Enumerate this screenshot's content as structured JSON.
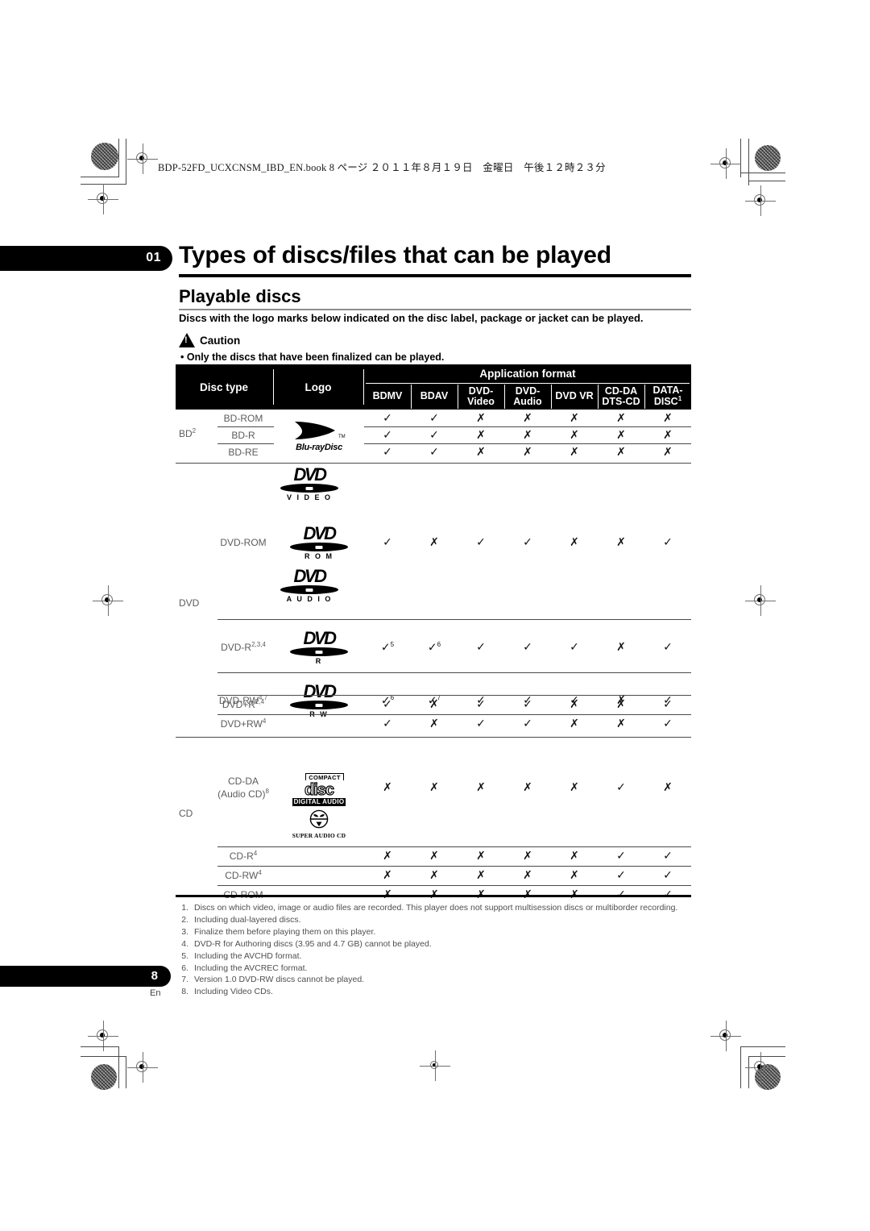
{
  "print_marks": {
    "file_info": "BDP-52FD_UCXCNSM_IBD_EN.book  8 ページ  ２０１１年８月１９日　金曜日　午後１２時２３分"
  },
  "chapter": {
    "number": "01",
    "title": "Types of discs/files that can be played"
  },
  "section": {
    "title": "Playable discs",
    "intro": "Discs with the logo marks below indicated on the disc label, package or jacket can be played."
  },
  "caution": {
    "label": "Caution",
    "bullet": "• Only the discs that have been finalized can be played."
  },
  "table": {
    "header": {
      "disc_type": "Disc type",
      "logo": "Logo",
      "application_format": "Application format",
      "columns": [
        {
          "line1": "BDMV",
          "line2": ""
        },
        {
          "line1": "BDAV",
          "line2": ""
        },
        {
          "line1": "DVD-",
          "line2": "Video"
        },
        {
          "line1": "DVD-",
          "line2": "Audio"
        },
        {
          "line1": "DVD VR",
          "line2": ""
        },
        {
          "line1": "CD-DA",
          "line2": "DTS-CD"
        },
        {
          "line1": "DATA-",
          "line2": "DISC",
          "sup": "1"
        }
      ]
    },
    "groups": [
      {
        "name": "BD",
        "name_sup": "2",
        "rows": [
          {
            "type": "BD-ROM",
            "marks": [
              "yes",
              "yes",
              "no",
              "no",
              "no",
              "no",
              "no"
            ]
          },
          {
            "type": "BD-R",
            "marks": [
              "yes",
              "yes",
              "no",
              "no",
              "no",
              "no",
              "no"
            ]
          },
          {
            "type": "BD-RE",
            "marks": [
              "yes",
              "yes",
              "no",
              "no",
              "no",
              "no",
              "no"
            ]
          }
        ],
        "logos": [
          "blu-ray-disc"
        ]
      },
      {
        "name": "DVD",
        "name_sup": "",
        "rows": [
          {
            "type": "DVD-ROM",
            "type_sup": "",
            "marks": [
              "yes",
              "no",
              "yes",
              "yes",
              "no",
              "no",
              "yes"
            ]
          },
          {
            "type": "DVD-R",
            "type_sup": "2,3,4",
            "marks": [
              "yes",
              "yes",
              "yes",
              "yes",
              "yes",
              "no",
              "yes"
            ],
            "mark_sups": [
              "5",
              "6",
              "",
              "",
              "",
              "",
              ""
            ]
          },
          {
            "type": "DVD-RW",
            "type_sup": "4,7",
            "marks": [
              "yes",
              "yes",
              "yes",
              "yes",
              "yes",
              "no",
              "yes"
            ],
            "mark_sups": [
              "6",
              "7",
              "",
              "",
              "",
              "",
              ""
            ]
          },
          {
            "type": "DVD+R",
            "type_sup": "2,4",
            "marks": [
              "yes",
              "no",
              "yes",
              "yes",
              "no",
              "no",
              "yes"
            ]
          },
          {
            "type": "DVD+RW",
            "type_sup": "4",
            "marks": [
              "yes",
              "no",
              "yes",
              "yes",
              "no",
              "no",
              "yes"
            ]
          }
        ],
        "logos": [
          "dvd-video",
          "dvd-rom",
          "dvd-audio",
          "dvd-r",
          "dvd-rw"
        ]
      },
      {
        "name": "CD",
        "name_sup": "",
        "rows": [
          {
            "type": "CD-DA",
            "type_line2": "(Audio CD)",
            "type_sup": "8",
            "marks": [
              "no",
              "no",
              "no",
              "no",
              "no",
              "yes",
              "no"
            ]
          },
          {
            "type": "CD-R",
            "type_sup": "4",
            "marks": [
              "no",
              "no",
              "no",
              "no",
              "no",
              "yes",
              "yes"
            ]
          },
          {
            "type": "CD-RW",
            "type_sup": "4",
            "marks": [
              "no",
              "no",
              "no",
              "no",
              "no",
              "yes",
              "yes"
            ]
          },
          {
            "type": "CD-ROM",
            "type_sup": "",
            "marks": [
              "no",
              "no",
              "no",
              "no",
              "no",
              "yes",
              "yes"
            ]
          }
        ],
        "logos": [
          "compact-disc-digital-audio",
          "super-audio-cd"
        ]
      }
    ],
    "marks": {
      "yes": "✓",
      "no": "✗"
    }
  },
  "logo_text": {
    "bluray_word": "Blu-rayDisc",
    "dvd_word": "DVD",
    "dvd_video_sub": "V I D E O",
    "dvd_rom_sub": "R O M",
    "dvd_audio_sub": "A U D I O",
    "dvd_r_sub": "R",
    "dvd_rw_sub": "R W",
    "cd_compact": "COMPACT",
    "cd_disc": "disc",
    "cd_digital_audio": "DIGITAL AUDIO",
    "sacd_text": "SUPER AUDIO CD"
  },
  "footnotes": [
    {
      "n": "1.",
      "text": "Discs on which video, image or audio files are recorded. This player does not support multisession discs or multiborder recording."
    },
    {
      "n": "2.",
      "text": "Including dual-layered discs."
    },
    {
      "n": "3.",
      "text": "Finalize them before playing them on this player."
    },
    {
      "n": "4.",
      "text": "DVD-R for Authoring discs (3.95 and 4.7 GB) cannot be played."
    },
    {
      "n": "5.",
      "text": "Including the AVCHD format."
    },
    {
      "n": "6.",
      "text": "Including the AVCREC format."
    },
    {
      "n": "7.",
      "text": "Version 1.0 DVD-RW discs cannot be played."
    },
    {
      "n": "8.",
      "text": "Including Video CDs."
    }
  ],
  "footer": {
    "page_number": "8",
    "language": "En"
  },
  "colors": {
    "ink": "#000000",
    "rule_gray": "#8d8d8d",
    "body_gray": "#5c5c5c",
    "reg_gray": "#6f6f6f"
  }
}
